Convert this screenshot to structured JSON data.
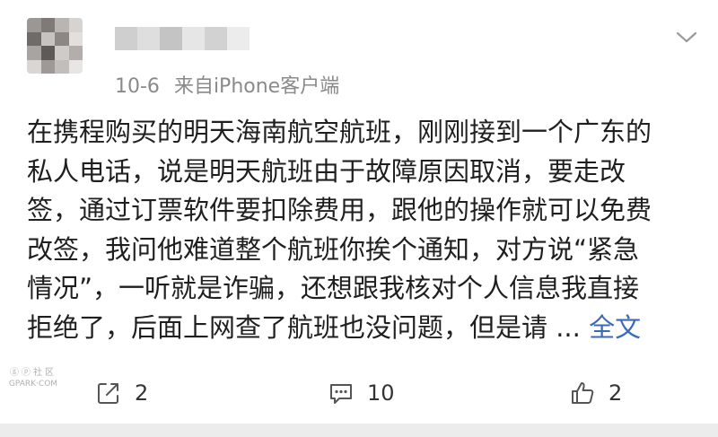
{
  "post": {
    "meta": {
      "date": "10-6",
      "source": "来自iPhone客户端"
    },
    "text_lines": [
      "在携程购买的明天海南航空航班，刚刚接到一个广东的",
      "私人电话，说是明天航班由于故障原因取消，要走改",
      "签，通过订票软件要扣除费用，跟他的操作就可以免费",
      "改签，我问他难道整个航班你挨个通知，对方说“紧急",
      "情况”，一听就是诈骗，还想跟我核对个人信息我直接",
      "拒绝了，后面上网查了航班也没问题，但是请 ... "
    ],
    "more_label": "全文"
  },
  "actions": {
    "share_count": "2",
    "comment_count": "10",
    "like_count": "2"
  },
  "watermark": {
    "top": "ⓖⓟ社区",
    "bottom": "GPARK·COM"
  },
  "icons": {
    "menu": "chevron-down-icon",
    "share": "share-icon",
    "comment": "comment-icon",
    "like": "thumbs-up-icon"
  },
  "colors": {
    "link": "#3b6bb8",
    "meta": "#8a8a8a",
    "text": "#1f1f1f",
    "divider_strip": "#ececec"
  }
}
